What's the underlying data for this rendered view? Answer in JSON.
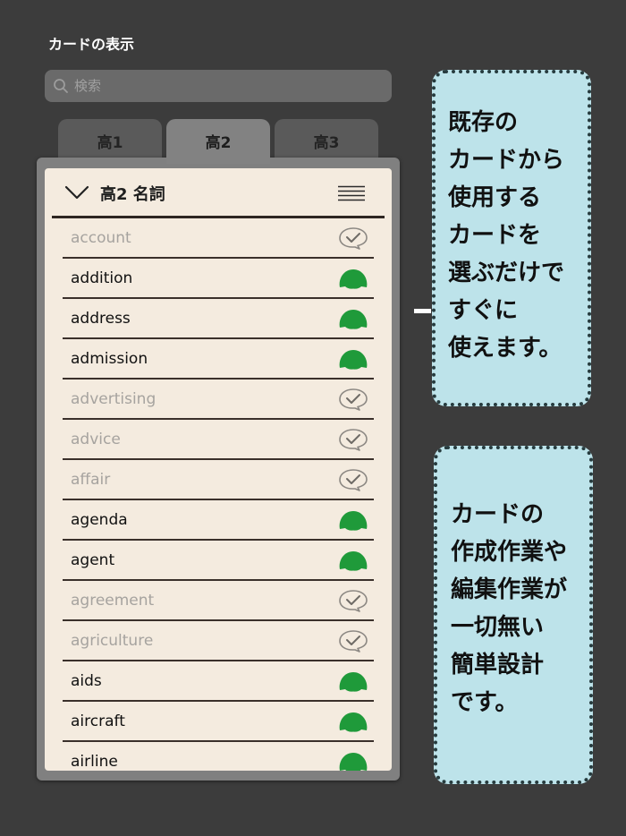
{
  "screen": {
    "title": "カードの表示"
  },
  "search": {
    "placeholder": "検索"
  },
  "tabs": [
    {
      "label": "高1",
      "active": false
    },
    {
      "label": "高2",
      "active": true
    },
    {
      "label": "高3",
      "active": false
    }
  ],
  "panel": {
    "title": "高2 名詞"
  },
  "words": [
    {
      "word": "account",
      "status": "learned",
      "icon": "check-bubble-icon"
    },
    {
      "word": "addition",
      "status": "unlearned",
      "icon": "green-dome-icon"
    },
    {
      "word": "address",
      "status": "unlearned",
      "icon": "green-dome-icon"
    },
    {
      "word": "admission",
      "status": "unlearned",
      "icon": "green-dome-icon"
    },
    {
      "word": "advertising",
      "status": "learned",
      "icon": "check-bubble-icon"
    },
    {
      "word": "advice",
      "status": "learned",
      "icon": "check-bubble-icon"
    },
    {
      "word": "affair",
      "status": "learned",
      "icon": "check-bubble-icon"
    },
    {
      "word": "agenda",
      "status": "unlearned",
      "icon": "green-dome-icon"
    },
    {
      "word": "agent",
      "status": "unlearned",
      "icon": "green-dome-icon"
    },
    {
      "word": "agreement",
      "status": "learned",
      "icon": "check-bubble-icon"
    },
    {
      "word": "agriculture",
      "status": "learned",
      "icon": "check-bubble-icon"
    },
    {
      "word": "aids",
      "status": "unlearned",
      "icon": "green-dome-icon"
    },
    {
      "word": "aircraft",
      "status": "unlearned",
      "icon": "green-dome-icon"
    },
    {
      "word": "airline",
      "status": "unlearned",
      "icon": "green-dome-icon"
    }
  ],
  "callouts": [
    {
      "lines": [
        "既存の",
        "カードから",
        "使用する",
        "カードを",
        "選ぶだけで",
        "すぐに",
        "使えます。"
      ]
    },
    {
      "lines": [
        "カードの",
        "作成作業や",
        "編集作業が",
        "一切無い",
        "簡単設計",
        "です。"
      ]
    }
  ],
  "colors": {
    "background": "#3c3c3c",
    "panel": "#f4ebdf",
    "accent_green": "#1f9a3a",
    "callout_bg": "#bde3ea",
    "learned_text": "#a6a39f"
  }
}
